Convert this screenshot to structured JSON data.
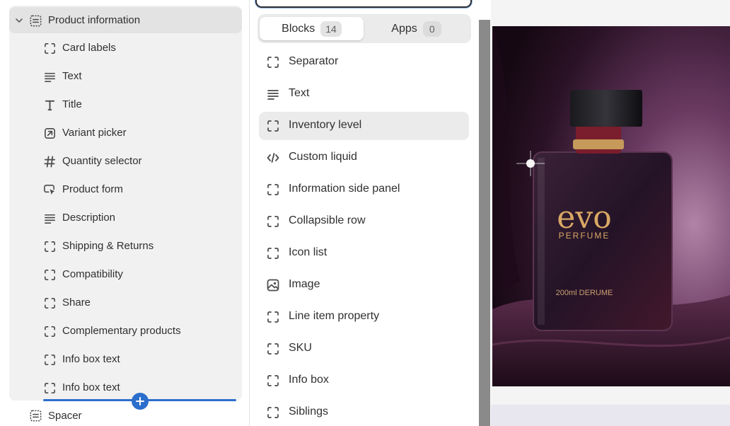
{
  "sidebar": {
    "section": {
      "label": "Product information",
      "icon": "section-icon",
      "expanded": true
    },
    "items": [
      {
        "label": "Card labels",
        "icon": "block-icon"
      },
      {
        "label": "Text",
        "icon": "text-lines-icon"
      },
      {
        "label": "Title",
        "icon": "title-t-icon"
      },
      {
        "label": "Variant picker",
        "icon": "variant-picker-icon"
      },
      {
        "label": "Quantity selector",
        "icon": "hashtag-icon"
      },
      {
        "label": "Product form",
        "icon": "cursor-form-icon"
      },
      {
        "label": "Description",
        "icon": "text-lines-icon"
      },
      {
        "label": "Shipping & Returns",
        "icon": "block-icon"
      },
      {
        "label": "Compatibility",
        "icon": "block-icon"
      },
      {
        "label": "Share",
        "icon": "block-icon"
      },
      {
        "label": "Complementary products",
        "icon": "block-icon"
      },
      {
        "label": "Info box text",
        "icon": "block-icon"
      },
      {
        "label": "Info box text",
        "icon": "block-icon"
      }
    ],
    "next_section": {
      "label": "Spacer",
      "icon": "section-icon"
    },
    "insert_color": "#2c6ecb"
  },
  "picker": {
    "search_placeholder": "",
    "tabs": [
      {
        "label": "Blocks",
        "count": "14",
        "selected": true
      },
      {
        "label": "Apps",
        "count": "0",
        "selected": false
      }
    ],
    "blocks": [
      {
        "label": "Separator",
        "icon": "block-icon"
      },
      {
        "label": "Text",
        "icon": "text-lines-icon"
      },
      {
        "label": "Inventory level",
        "icon": "block-icon",
        "hovered": true
      },
      {
        "label": "Custom liquid",
        "icon": "code-icon"
      },
      {
        "label": "Information side panel",
        "icon": "block-icon"
      },
      {
        "label": "Collapsible row",
        "icon": "block-icon"
      },
      {
        "label": "Icon list",
        "icon": "block-icon"
      },
      {
        "label": "Image",
        "icon": "image-icon"
      },
      {
        "label": "Line item property",
        "icon": "block-icon"
      },
      {
        "label": "SKU",
        "icon": "block-icon"
      },
      {
        "label": "Info box",
        "icon": "block-icon"
      },
      {
        "label": "Siblings",
        "icon": "block-icon"
      }
    ]
  },
  "preview": {
    "product_image": {
      "brand": "evo",
      "sub_brand": "PERFUME",
      "volume_text": "200ml DERUME"
    }
  },
  "colors": {
    "accent": "#2c6ecb",
    "text": "#303030",
    "hover": "#ebebeb"
  }
}
